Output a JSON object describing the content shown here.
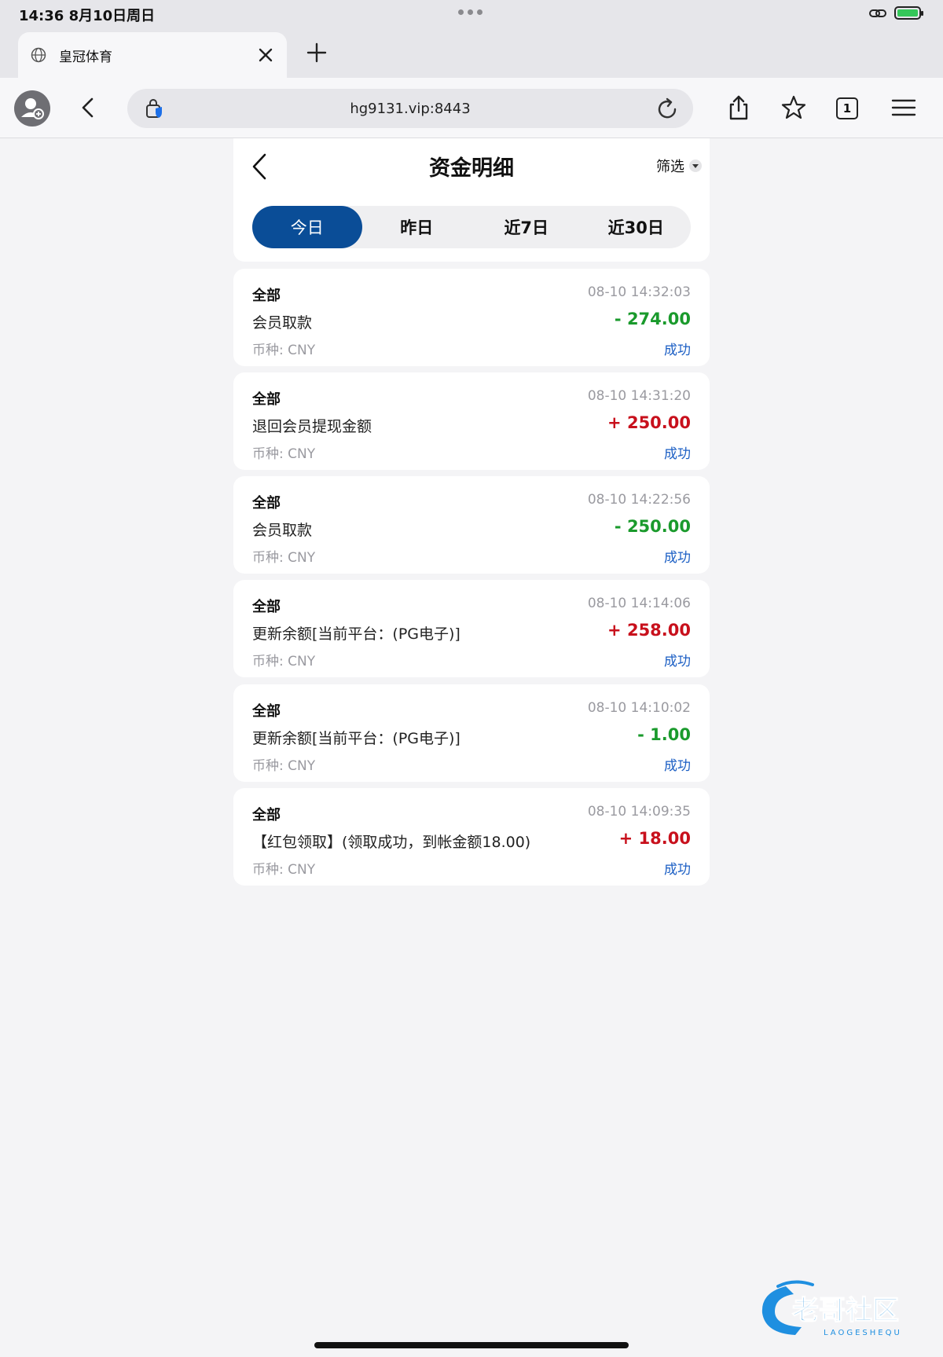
{
  "status_bar": {
    "time_date": "14:36   8月10日周日"
  },
  "browser": {
    "tab_title": "皇冠体育",
    "url": "hg9131.vip:8443",
    "tab_count": "1"
  },
  "page": {
    "title": "资金明细",
    "filter_label": "筛选",
    "tabs": [
      {
        "label": "今日",
        "active": true
      },
      {
        "label": "昨日",
        "active": false
      },
      {
        "label": "近7日",
        "active": false
      },
      {
        "label": "近30日",
        "active": false
      }
    ]
  },
  "records": [
    {
      "category": "全部",
      "time": "08-10 14:32:03",
      "description": "会员取款",
      "amount": "- 274.00",
      "sign": "neg",
      "currency": "币种: CNY",
      "status": "成功"
    },
    {
      "category": "全部",
      "time": "08-10 14:31:20",
      "description": "退回会员提现金额",
      "amount": "+ 250.00",
      "sign": "pos",
      "currency": "币种: CNY",
      "status": "成功"
    },
    {
      "category": "全部",
      "time": "08-10 14:22:56",
      "description": "会员取款",
      "amount": "- 250.00",
      "sign": "neg",
      "currency": "币种: CNY",
      "status": "成功"
    },
    {
      "category": "全部",
      "time": "08-10 14:14:06",
      "description": "更新余额[当前平台：(PG电子)]",
      "amount": "+ 258.00",
      "sign": "pos",
      "currency": "币种: CNY",
      "status": "成功"
    },
    {
      "category": "全部",
      "time": "08-10 14:10:02",
      "description": "更新余额[当前平台：(PG电子)]",
      "amount": "- 1.00",
      "sign": "neg",
      "currency": "币种: CNY",
      "status": "成功"
    },
    {
      "category": "全部",
      "time": "08-10 14:09:35",
      "description": "【红包领取】(领取成功，到帐金额18.00)",
      "amount": "+ 18.00",
      "sign": "pos",
      "currency": "币种: CNY",
      "status": "成功"
    }
  ],
  "watermark": {
    "text": "老哥社区",
    "subtext": "LAOGESHEQU"
  },
  "colors": {
    "active_tab": "#0a4d97",
    "negative_amount": "#1a9a2c",
    "positive_amount": "#c8101c",
    "status_success": "#1c5fc4"
  },
  "icons": [
    "globe-icon",
    "close-icon",
    "plus-icon",
    "profile-icon",
    "chevron-left-icon",
    "lock-shield-icon",
    "reload-icon",
    "share-icon",
    "star-icon",
    "tabs-icon",
    "menu-icon",
    "link-icon",
    "battery-icon",
    "caret-down-icon"
  ]
}
